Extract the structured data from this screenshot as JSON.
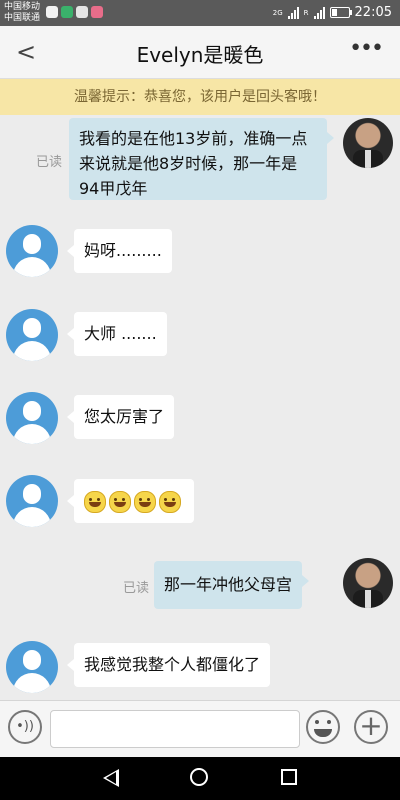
{
  "status_bar": {
    "carrier_1": "中国移动",
    "carrier_2": "中国联通",
    "network_1": "2G",
    "network_2": "R",
    "time": "22:05"
  },
  "header": {
    "title": "Evelyn是暖色",
    "back_icon": "chevron-left-icon",
    "more_icon": "more-dots-icon",
    "more_label": "•••"
  },
  "notice": {
    "text": "温馨提示：恭喜您，该用户是回头客哦！",
    "background": "#f7e6a6"
  },
  "messages": [
    {
      "from": "me",
      "read": "已读",
      "text": "我看的是在他13岁前，准确一点来说就是他8岁时候，那一年是94甲戊年"
    },
    {
      "from": "other",
      "text": "妈呀........."
    },
    {
      "from": "other",
      "text": "大师 ......."
    },
    {
      "from": "other",
      "text": "您太厉害了"
    },
    {
      "from": "other",
      "emoji_count": 4,
      "emoji_name": "smile-emoji"
    },
    {
      "from": "me",
      "read": "已读",
      "text": "那一年冲他父母宫"
    },
    {
      "from": "other",
      "text": "我感觉我整个人都僵化了"
    }
  ],
  "input_bar": {
    "voice_icon": "voice-icon",
    "voice_glyph": "•))",
    "emoji_icon": "emoji-icon",
    "plus_icon": "plus-icon",
    "plus_glyph": "+"
  },
  "colors": {
    "my_bubble": "#cfe4ec",
    "other_bubble": "#ffffff",
    "avatar_other": "#4d9cd8"
  }
}
